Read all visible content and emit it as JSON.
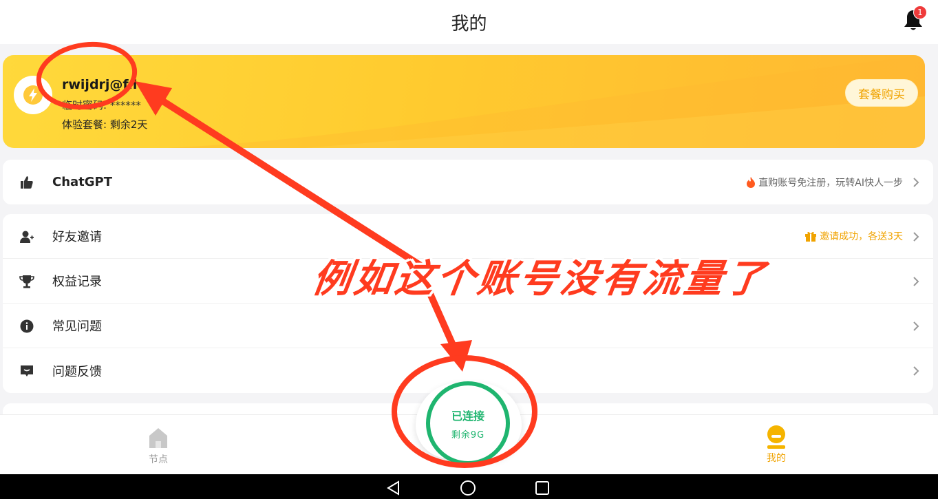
{
  "header": {
    "title": "我的",
    "notification_count": "1"
  },
  "profile": {
    "email": "rwijdrj@f.l",
    "temp_password": "临时密码: ******",
    "plan": "体验套餐: 剩余2天",
    "buy_button": "套餐购买"
  },
  "chatgpt_row": {
    "label": "ChatGPT",
    "promo": "直购账号免注册，玩转AI快人一步"
  },
  "menu": {
    "invite": {
      "label": "好友邀请",
      "promo": "邀请成功，各送3天"
    },
    "benefits": {
      "label": "权益记录"
    },
    "faq": {
      "label": "常见问题"
    },
    "feedback": {
      "label": "问题反馈"
    }
  },
  "connection": {
    "status": "已连接",
    "remaining": "剩余9G"
  },
  "tabbar": {
    "nodes": "节点",
    "mine": "我的"
  },
  "annotation": {
    "text": "例如这个账号没有流量了"
  },
  "colors": {
    "accent": "#f0a300",
    "connected": "#1fb56f",
    "annotation": "#ff3b1f",
    "badge": "#ef3b3b"
  }
}
